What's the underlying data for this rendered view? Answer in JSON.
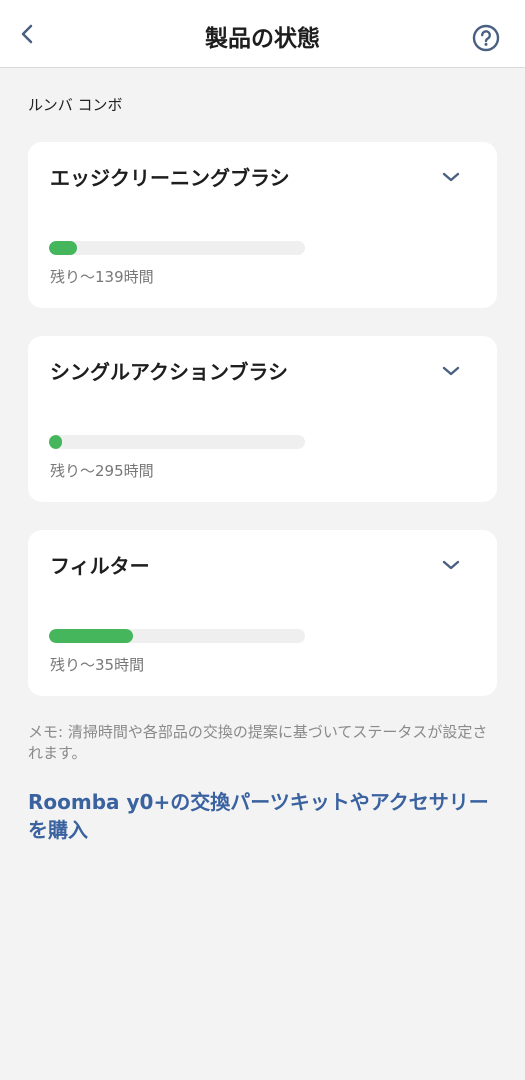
{
  "header": {
    "title": "製品の状態",
    "back_icon": "chevron-left-icon",
    "help_icon": "question-circle-icon"
  },
  "section_label": "ルンバ コンボ",
  "cards": [
    {
      "title": "エッジクリーニングブラシ",
      "remaining": "残り〜139時間",
      "level_percent": 11
    },
    {
      "title": "シングルアクションブラシ",
      "remaining": "残り〜295時間",
      "level_percent": 5
    },
    {
      "title": "フィルター",
      "remaining": "残り〜35時間",
      "level_percent": 33
    }
  ],
  "note": "メモ: 清掃時間や各部品の交換の提案に基づいてステータスが設定されます。",
  "buy_link": "Roomba y0+の交換パーツキットやアクセサリーを購入",
  "colors": {
    "bar_fill": "#45b65b",
    "bar_track": "#efefef",
    "link": "#3a62a0",
    "icon": "#4a6080"
  }
}
